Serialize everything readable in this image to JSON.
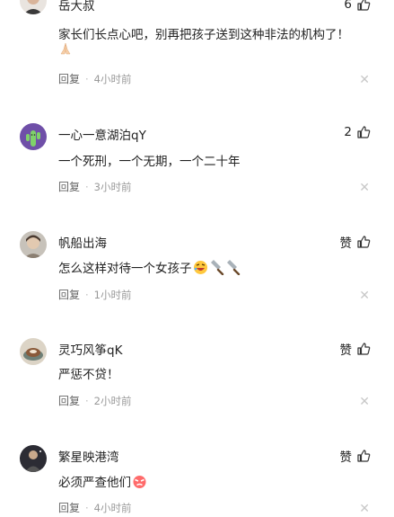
{
  "comments": [
    {
      "username": "岳大叔",
      "likes": "6",
      "content": "家长们长点心吧，别再把孩子送到这种非法的机构了！",
      "emoji_line": "pray-emoji",
      "reply": "回复",
      "time": "4小时前"
    },
    {
      "username": "一心一意湖泊qY",
      "likes": "2",
      "content": "一个死刑，一个无期，一个二十年",
      "reply": "回复",
      "time": "3小时前"
    },
    {
      "username": "帆船出海",
      "likes": "赞",
      "content": "怎么这样对待一个女孩子",
      "emojis": [
        "rolling-laugh-emoji",
        "cleaver-emoji",
        "cleaver-emoji"
      ],
      "reply": "回复",
      "time": "1小时前"
    },
    {
      "username": "灵巧风筝qK",
      "likes": "赞",
      "content": "严惩不贷！",
      "reply": "回复",
      "time": "2小时前"
    },
    {
      "username": "繁星映港湾",
      "likes": "赞",
      "content": "必须严查他们",
      "emojis": [
        "angry-face-emoji"
      ],
      "reply": "回复",
      "time": "4小时前"
    }
  ],
  "colors": {
    "text": "#222222",
    "meta": "#999999",
    "close": "#c8c8c8"
  }
}
